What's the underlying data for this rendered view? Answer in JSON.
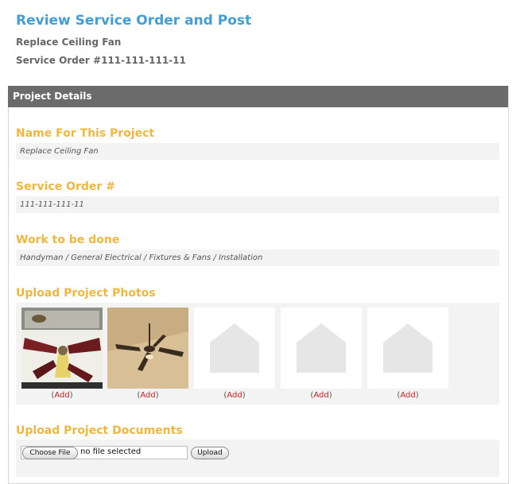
{
  "header": {
    "title": "Review Service Order and Post",
    "project_name": "Replace Ceiling Fan",
    "service_order": "Service Order #111-111-111-11"
  },
  "panel": {
    "title": "Project Details"
  },
  "fields": {
    "name": {
      "label": "Name For This Project",
      "value": "Replace Ceiling Fan"
    },
    "order": {
      "label": "Service Order #",
      "value": "111-111-111-11"
    },
    "work": {
      "label": "Work to be done",
      "value": "Handyman / General Electrical / Fixtures & Fans / Installation"
    }
  },
  "photos": {
    "label": "Upload Project Photos",
    "items": [
      {
        "kind": "photo-fan-box",
        "add_label": "Add"
      },
      {
        "kind": "photo-ceiling-fan",
        "add_label": "Add"
      },
      {
        "kind": "placeholder",
        "add_label": "Add"
      },
      {
        "kind": "placeholder",
        "add_label": "Add"
      },
      {
        "kind": "placeholder",
        "add_label": "Add"
      }
    ]
  },
  "documents": {
    "label": "Upload Project Documents",
    "choose_label": "Choose File",
    "file_status": "no file selected",
    "upload_label": "Upload"
  },
  "colors": {
    "title": "#3f9fd6",
    "section_label": "#f0b73f",
    "panel_header": "#6b6b6b",
    "add_link": "#cc2222"
  }
}
